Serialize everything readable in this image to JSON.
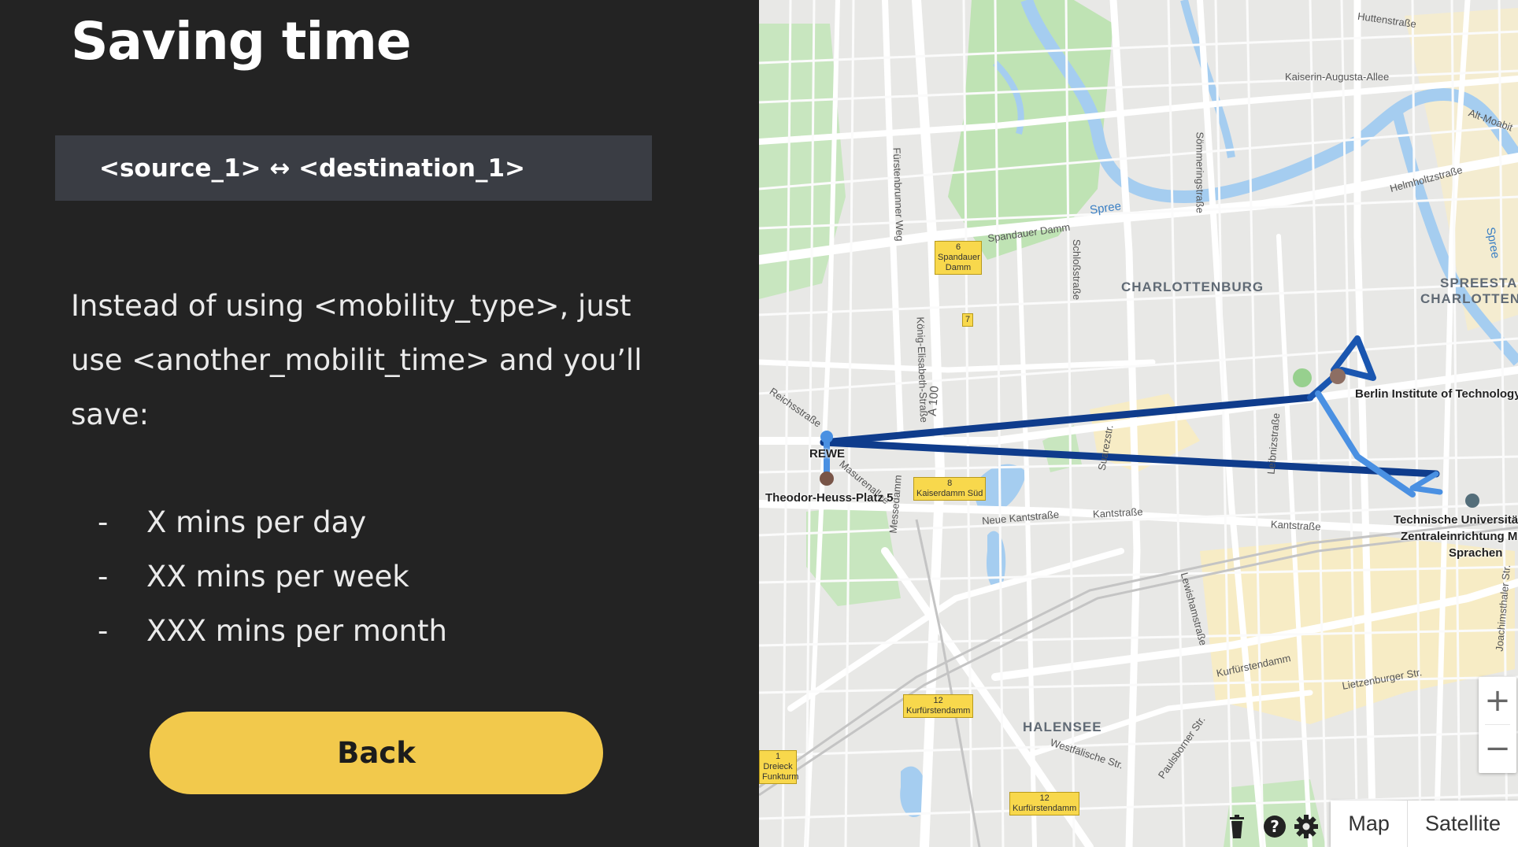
{
  "panel": {
    "title": "Saving time",
    "route_text": "<source_1> ↔ <destination_1>",
    "description": "Instead of using <mobility_type>, just use <another_mobilit_time> and you’ll save:",
    "savings": [
      {
        "dash": "-",
        "text": "X mins per day"
      },
      {
        "dash": "-",
        "text": "XX mins per week"
      },
      {
        "dash": "-",
        "text": "XXX mins per month"
      }
    ],
    "back_label": "Back",
    "accent_color": "#f2c94c"
  },
  "map": {
    "districts": [
      "CHARLOTTENBURG",
      "HALENSEE",
      "SPREESTADT",
      "CHARLOTTENB"
    ],
    "streets": [
      "Huttenstraße",
      "Kaiserin-Augusta-Allee",
      "Alt-Moabit",
      "Helmholtzstraße",
      "Spandauer Damm",
      "Schloßstraße",
      "Fürstenbrunner Weg",
      "Sömmeringstraße",
      "Reichsstraße",
      "König-Elisabeth-Straße",
      "Messedamm",
      "Neue Kantstraße",
      "Kantstraße",
      "Kantstraße",
      "Suarezstr.",
      "Leibnizstraße",
      "Lewishamstraße",
      "Kurfürstendamm",
      "Lietzenburger Str.",
      "Westfälische Str.",
      "Paulsborner Str.",
      "Joachimsthaler Str.",
      "A 100",
      "Masurenallee"
    ],
    "rivers": [
      "Spree",
      "Spree"
    ],
    "exits": [
      {
        "num": "6",
        "name": "Spandauer Damm"
      },
      {
        "num": "7",
        "name": ""
      },
      {
        "num": "8",
        "name": "Kaiserdamm Süd"
      },
      {
        "num": "12",
        "name": "Kurfürstendamm"
      },
      {
        "num": "12",
        "name": "Kurfürstendamm"
      },
      {
        "num": "1",
        "name": "Dreieck Funkturm"
      }
    ],
    "places": {
      "rewe": "REWE",
      "theodor": "Theodor-Heuss-Platz 5",
      "bit": "Berlin Institute of Technology",
      "tu_line1": "Technische Universität",
      "tu_line2": "Zentraleinrichtung Mo",
      "tu_line3": "Sprachen"
    },
    "map_type": {
      "map": "Map",
      "satellite": "Satellite"
    },
    "zoom": {
      "plus": "+",
      "minus": "−"
    },
    "route_color": "#0f3c8c",
    "icons": [
      "apps-grid-icon",
      "avatar",
      "trash-icon",
      "help-icon",
      "settings-gear-icon"
    ]
  }
}
